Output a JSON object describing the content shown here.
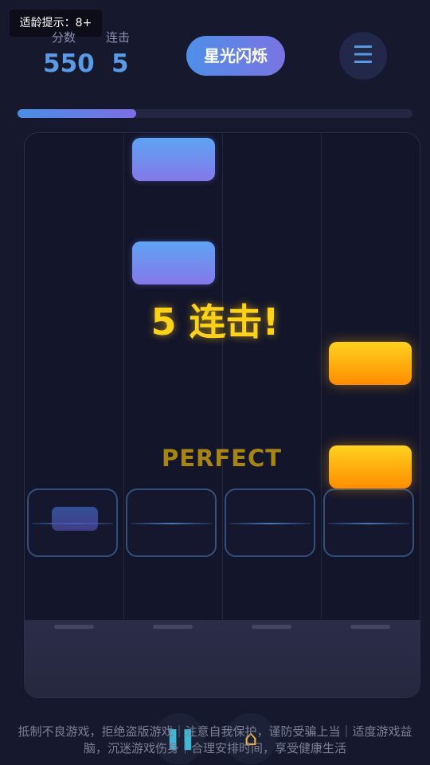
{
  "age_badge": "适龄提示：8+",
  "stats": {
    "score_label": "分数",
    "score_value": "550",
    "combo_label": "连击",
    "combo_value": "5"
  },
  "song_title": "星光闪烁",
  "menu_icon": "hamburger-menu-icon",
  "progress_fraction": 0.3,
  "board": {
    "lanes": 4,
    "combo_text": "5 连击!",
    "judgement_text": "PERFECT"
  },
  "controls": {
    "pause_icon": "pause-icon",
    "home_icon": "home-icon"
  },
  "footer_notice": "抵制不良游戏，拒绝盗版游戏｜注意自我保护，谨防受骗上当｜适度游戏益脑，沉迷游戏伤身｜合理安排时间，享受健康生活",
  "colors": {
    "accent_blue": "#5a9be6",
    "combo_gold": "#ffd21a",
    "tile_gold": "#ffb000",
    "tile_blue": "#6f8ef0"
  }
}
